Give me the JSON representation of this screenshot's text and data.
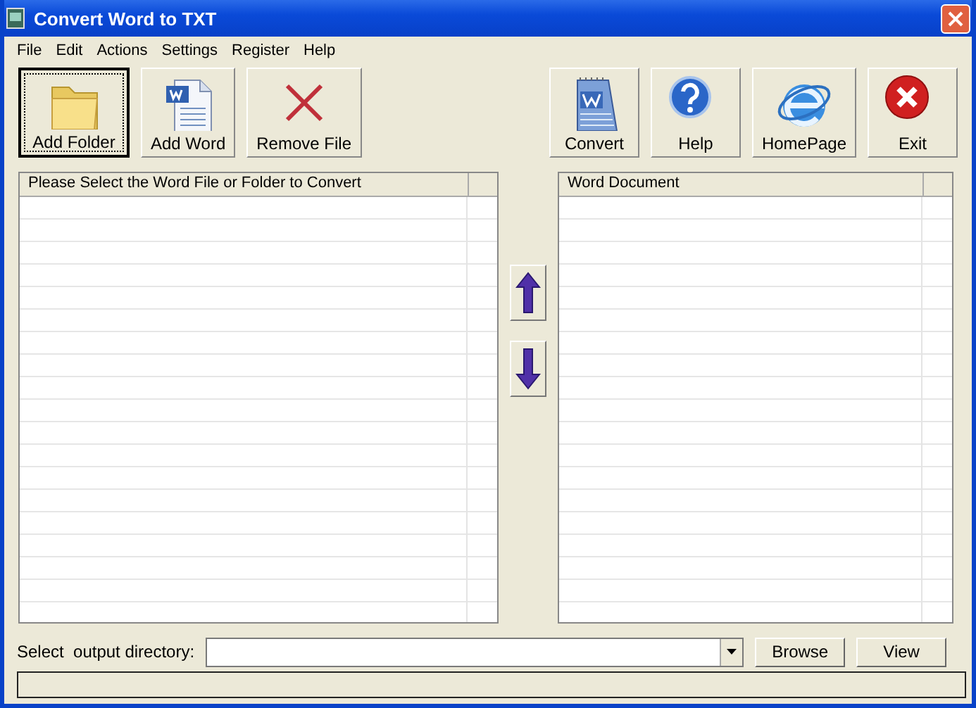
{
  "window": {
    "title": "Convert Word to TXT"
  },
  "menu": [
    {
      "label": "File"
    },
    {
      "label": "Edit"
    },
    {
      "label": "Actions"
    },
    {
      "label": "Settings"
    },
    {
      "label": "Register"
    },
    {
      "label": "Help"
    }
  ],
  "toolbar": {
    "left": [
      {
        "label": "Add Folder",
        "kind": "folder",
        "focused": true
      },
      {
        "label": "Add Word",
        "kind": "document",
        "focused": false
      },
      {
        "label": "Remove File",
        "kind": "remove",
        "focused": false
      }
    ],
    "right": [
      {
        "label": "Convert",
        "kind": "notepad",
        "focused": false
      },
      {
        "label": "Help",
        "kind": "help",
        "focused": false
      },
      {
        "label": "HomePage",
        "kind": "globe",
        "focused": false
      },
      {
        "label": "Exit",
        "kind": "exit",
        "focused": false
      }
    ]
  },
  "source_list": {
    "column_1": "Please Select the Word File or Folder to Convert"
  },
  "move_buttons": [
    {
      "kind": "up"
    },
    {
      "kind": "down"
    }
  ],
  "target_list": {
    "column_1": "Word Document"
  },
  "output": {
    "label": "Select  output directory:",
    "buttons": [
      "Browse",
      "View"
    ]
  }
}
